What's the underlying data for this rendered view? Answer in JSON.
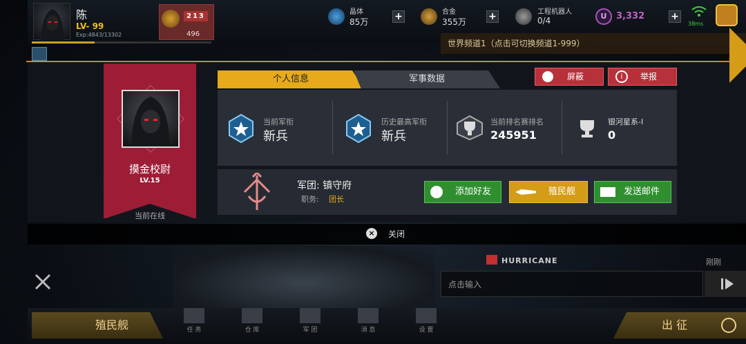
{
  "player": {
    "name": "陈",
    "level": "LV- 99",
    "exp": "Exp:4843/13302",
    "rank_value": "496",
    "podium": "213"
  },
  "resources": {
    "crystal": {
      "label": "晶体",
      "value": "85万"
    },
    "alloy": {
      "label": "合金",
      "value": "355万"
    },
    "robot": {
      "label": "工程机器人",
      "value": "0/4"
    },
    "u_currency": {
      "value": "3,332"
    },
    "ping": "38ms"
  },
  "world_channel": "世界频道1（点击可切换频道1-999）",
  "profile": {
    "title": "摸金校尉",
    "level": "LV.15",
    "status": "当前在线"
  },
  "tabs": {
    "personal": "个人信息",
    "military": "军事数据"
  },
  "actions": {
    "block": "屏蔽",
    "report": "举报"
  },
  "stats": [
    {
      "label": "当前军衔",
      "value": "新兵"
    },
    {
      "label": "历史最高军衔",
      "value": "新兵"
    },
    {
      "label": "当前排名赛排名",
      "value": "245951"
    },
    {
      "label": "银河星系-I",
      "value": "0"
    }
  ],
  "legion": {
    "name": "军团: 镇守府",
    "role_label": "职务:",
    "role": "团长"
  },
  "legion_buttons": {
    "add_friend": "添加好友",
    "colony_ship": "殖民舰",
    "send_mail": "发送邮件"
  },
  "close": "关闭",
  "chat": {
    "sender": "HURRICANE",
    "time": "刚刚",
    "placeholder": "点击输入"
  },
  "bottom": {
    "colony_ship": "殖民舰",
    "expedition": "出 征",
    "nav": [
      "任 务",
      "仓 库",
      "军 团",
      "消 息",
      "设 置"
    ]
  },
  "colors": {
    "accent": "#e6aa1b",
    "ribbon": "#9d1d36",
    "green": "#2f8f2f",
    "red": "#b8303a"
  }
}
